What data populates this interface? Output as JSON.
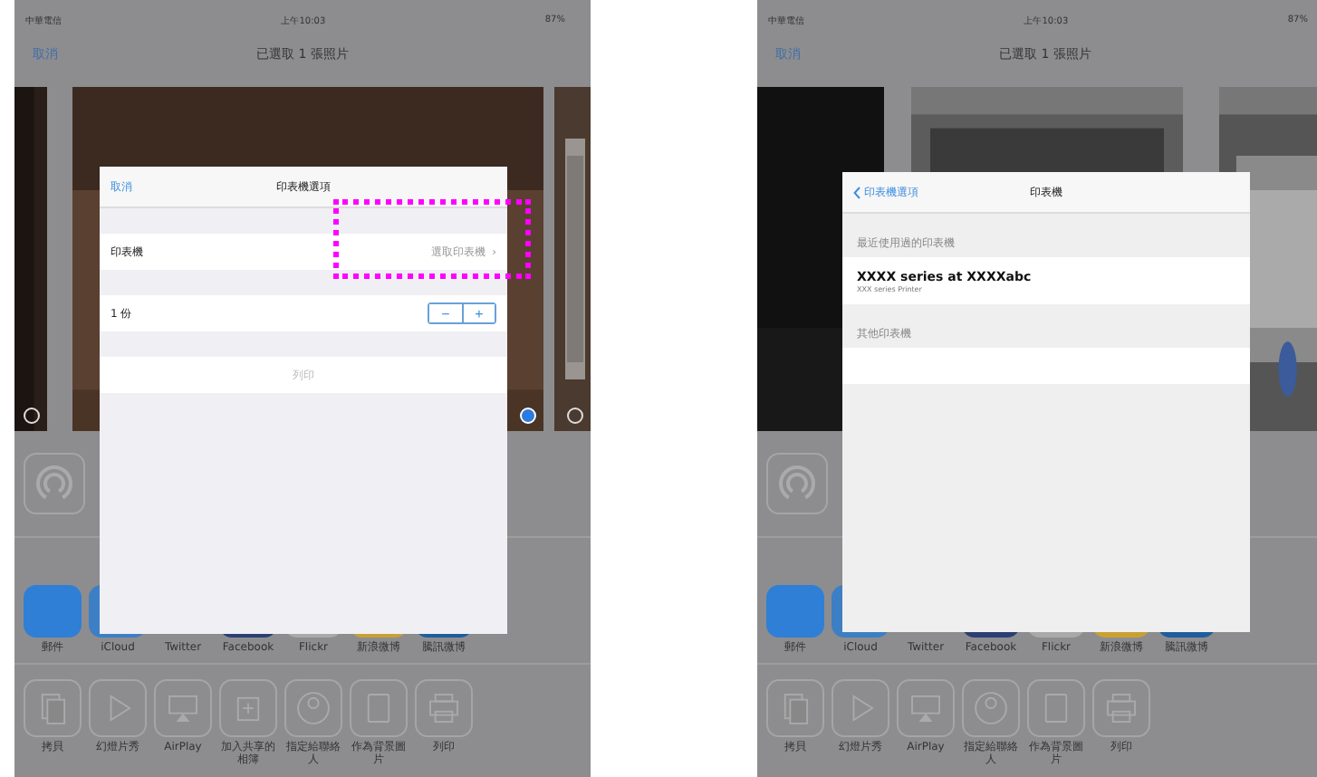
{
  "screens": [
    {
      "status_bar": {
        "carrier": "中華電信",
        "time": "上午10:03",
        "battery": "87%"
      },
      "nav": {
        "left": "取消",
        "title": "已選取 1 張照片"
      },
      "photos": [
        {
          "selected": false
        },
        {
          "selected": true
        },
        {
          "selected": false
        }
      ],
      "apps": [
        {
          "label": "郵件",
          "color": "#2f7fd6"
        },
        {
          "label": "iCloud",
          "color": "#3d7fc4"
        },
        {
          "label": "Twitter"
        },
        {
          "label": "Facebook",
          "color": "#2c3f73"
        },
        {
          "label": "Flickr",
          "color": "#a9a9a9"
        },
        {
          "label": "新浪微博",
          "color": "#c9a033"
        },
        {
          "label": "騰訊微博",
          "color": "#1e5d9e"
        }
      ],
      "actions": [
        {
          "label": "拷貝",
          "kind": "copy"
        },
        {
          "label": "幻燈片秀",
          "kind": "play"
        },
        {
          "label": "AirPlay",
          "kind": "airplay"
        },
        {
          "label": "加入共享的相簿",
          "kind": "album"
        },
        {
          "label": "指定給聯絡人",
          "kind": "contact"
        },
        {
          "label": "作為背景圖片",
          "kind": "device"
        },
        {
          "label": "列印",
          "kind": "print"
        }
      ],
      "popover": {
        "back": "取消",
        "back_arrow": false,
        "title": "印表機選項",
        "rows": [
          {
            "kind": "gap"
          },
          {
            "kind": "link",
            "label": "印表機",
            "value": "選取印表機",
            "chevron": "›",
            "highlighted": true
          },
          {
            "kind": "gap"
          },
          {
            "kind": "stepper",
            "label": "1 份",
            "minus": "−",
            "plus": "+"
          },
          {
            "kind": "gap"
          },
          {
            "kind": "action",
            "label": "列印",
            "disabled": true
          }
        ]
      }
    },
    {
      "status_bar": {
        "carrier": "中華電信",
        "time": "上午10:03",
        "battery": "87%"
      },
      "nav": {
        "left": "取消",
        "title": "已選取 1 張照片"
      },
      "apps": [
        {
          "label": "郵件",
          "color": "#2f7fd6"
        },
        {
          "label": "iCloud",
          "color": "#3d7fc4"
        },
        {
          "label": "Twitter"
        },
        {
          "label": "Facebook",
          "color": "#2c3f73"
        },
        {
          "label": "Flickr",
          "color": "#a9a9a9"
        },
        {
          "label": "新浪微博",
          "color": "#c9a033"
        },
        {
          "label": "騰訊微博",
          "color": "#1e5d9e"
        }
      ],
      "actions": [
        {
          "label": "拷貝",
          "kind": "copy"
        },
        {
          "label": "幻燈片秀",
          "kind": "play"
        },
        {
          "label": "AirPlay",
          "kind": "airplay"
        },
        {
          "label": "指定給聯絡人",
          "kind": "contact"
        },
        {
          "label": "作為背景圖片",
          "kind": "device"
        },
        {
          "label": "列印",
          "kind": "print"
        }
      ],
      "popover": {
        "back": "印表機選項",
        "back_arrow": true,
        "title": "印表機",
        "rows": [
          {
            "kind": "header",
            "label": "最近使用過的印表機"
          },
          {
            "kind": "printer",
            "name": "XXXX series at  XXXXabc",
            "model": "XXX series Printer"
          },
          {
            "kind": "header",
            "label": "其他印表機"
          },
          {
            "kind": "blank"
          }
        ]
      }
    }
  ]
}
